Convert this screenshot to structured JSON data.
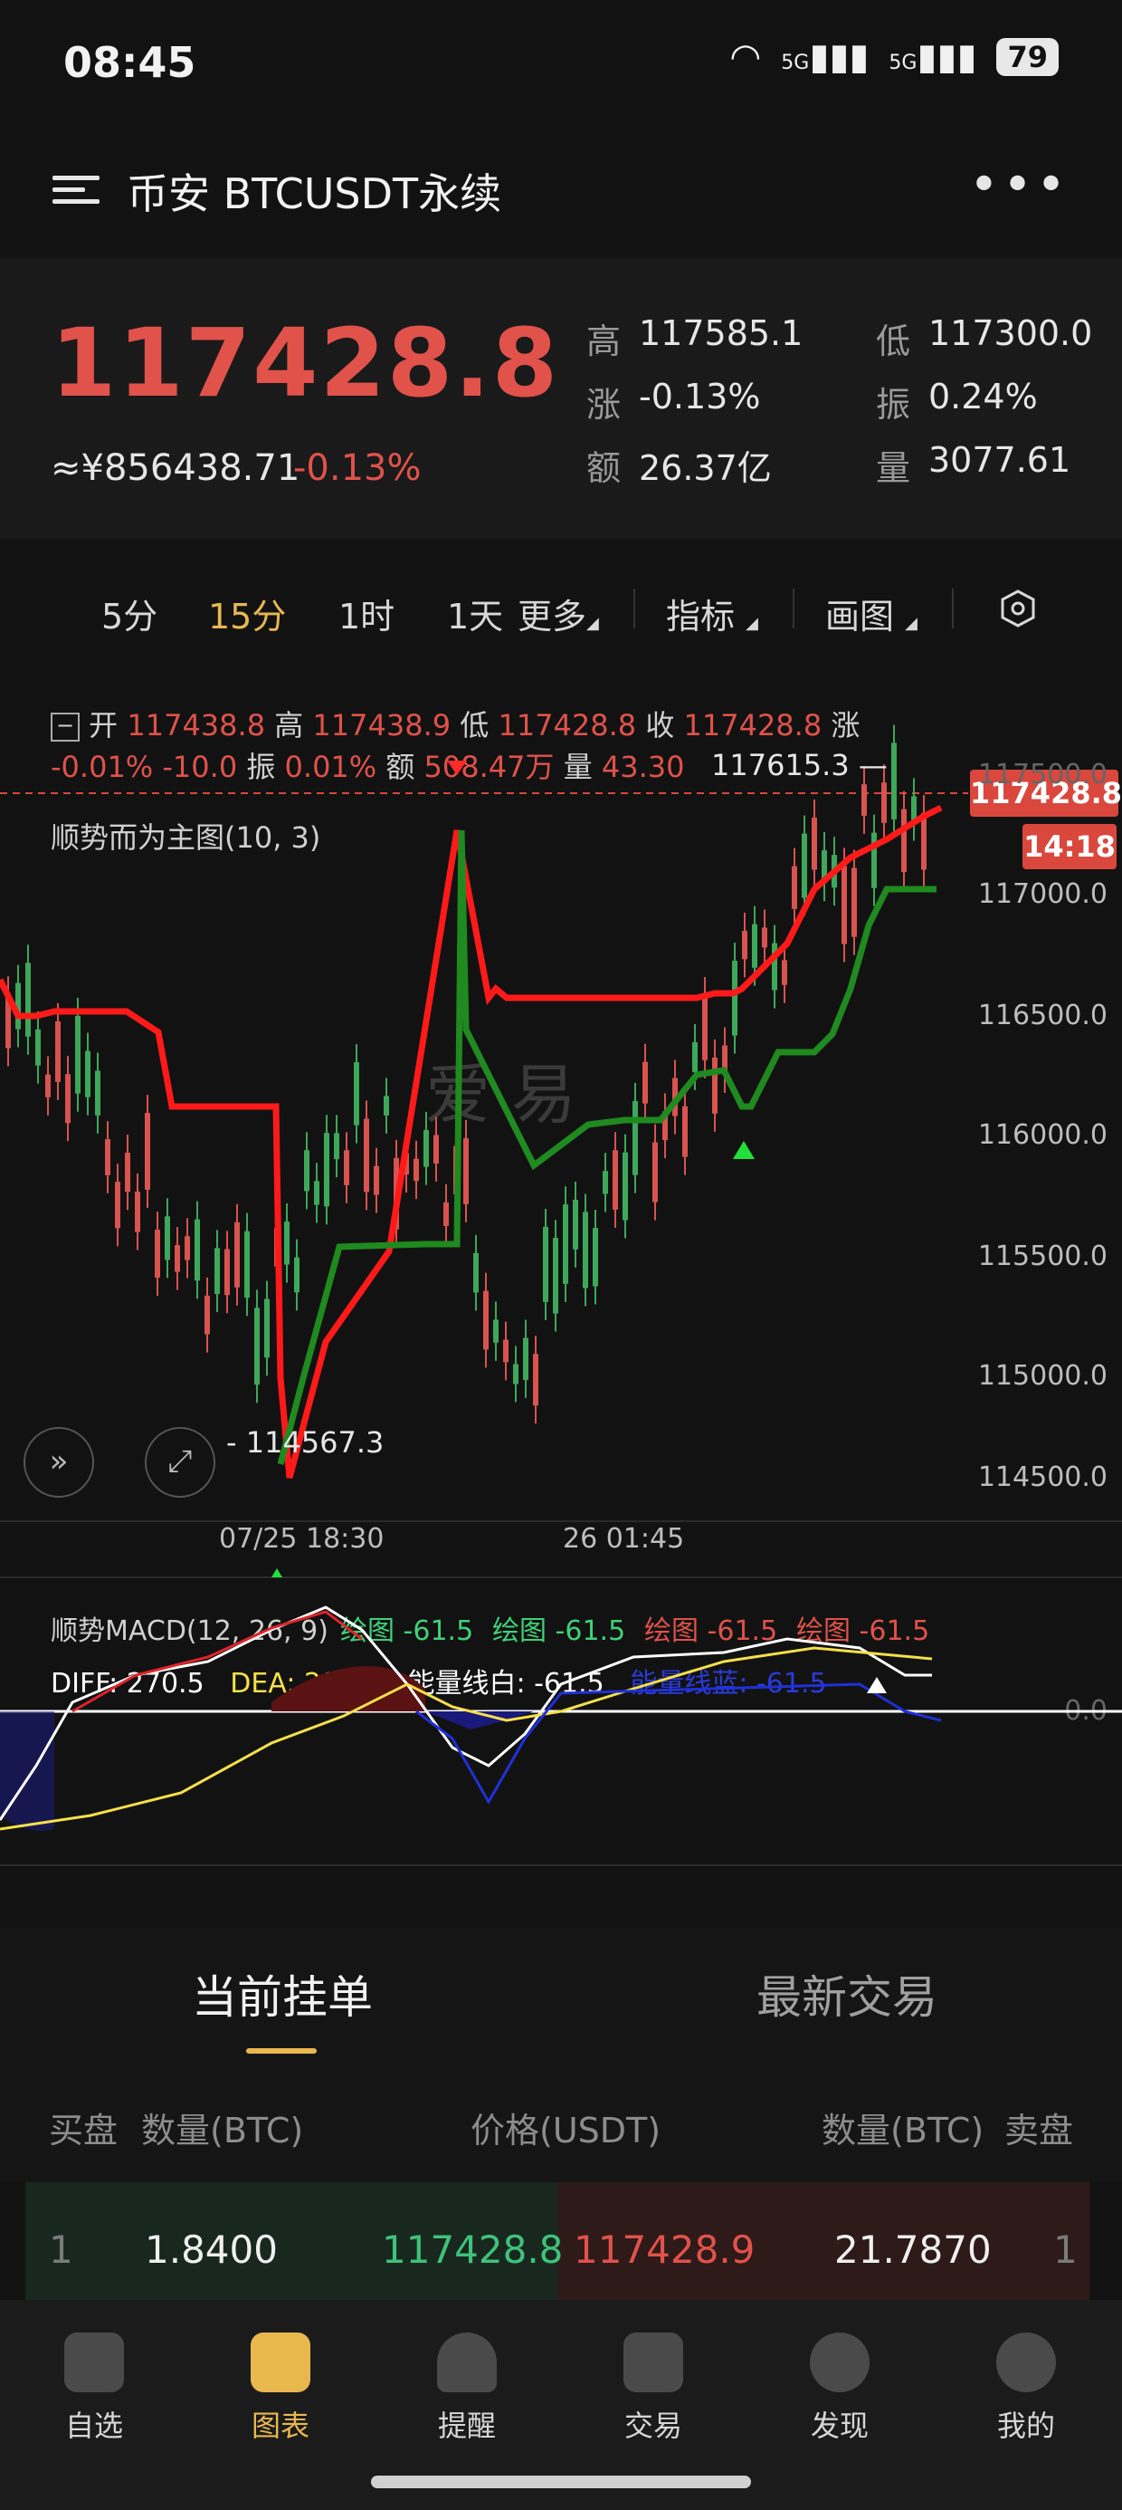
{
  "status_bar": {
    "time": "08:45",
    "signal1": "5G",
    "signal2": "5G",
    "battery": "79"
  },
  "header": {
    "title": "币安 BTCUSDT永续"
  },
  "ticker": {
    "last_price": "117428.8",
    "cny_price": "≈¥856438.71",
    "change_pct": "-0.13%",
    "stats": [
      {
        "label": "高",
        "value": "117585.1"
      },
      {
        "label": "低",
        "value": "117300.0"
      },
      {
        "label": "涨",
        "value": "-0.13%"
      },
      {
        "label": "振",
        "value": "0.24%"
      },
      {
        "label": "额",
        "value": "26.37亿"
      },
      {
        "label": "量",
        "value": "3077.61"
      }
    ]
  },
  "timeframes": {
    "items": [
      "5分",
      "15分",
      "1时",
      "1天",
      "更多"
    ],
    "active": "15分",
    "indicator": "指标",
    "draw": "画图"
  },
  "chart": {
    "ohlc": {
      "open_label": "开",
      "open": "117438.8",
      "high_label": "高",
      "high": "117438.9",
      "low_label": "低",
      "low": "117428.8",
      "close_label": "收",
      "close": "117428.8",
      "chg_label": "涨",
      "chg_pct": "-0.01%",
      "chg_abs": "-10.0",
      "amp_label": "振",
      "amp": "0.01%",
      "amt_label": "额",
      "amt": "508.47万",
      "vol_label": "量",
      "vol": "43.30"
    },
    "indicator_label": "顺势而为主图(10, 3)",
    "price_tag": "117428.8",
    "countdown": "14:18",
    "high_marker": "117615.3",
    "low_marker": "114567.3",
    "watermark": "爱 易",
    "y_ticks": [
      "117500.0",
      "117000.0",
      "116500.0",
      "116000.0",
      "115500.0",
      "115000.0",
      "114500.0"
    ],
    "x_ticks": [
      "07/25 18:30",
      "26 01:45"
    ]
  },
  "macd": {
    "title": "顺势MACD(12, 26, 9)",
    "plots": [
      {
        "label": "绘图 -61.5",
        "color": "#3fd27a"
      },
      {
        "label": "绘图 -61.5",
        "color": "#3fd27a"
      },
      {
        "label": "绘图 -61.5",
        "color": "#e0524a"
      },
      {
        "label": "绘图 -61.5",
        "color": "#e0524a"
      }
    ],
    "diff": "DIFF: 270.5",
    "dea": "DEA: 288.0",
    "energy_white": "能量线白: -61.5",
    "energy_blue": "能量线蓝: -61.5",
    "zero_tick": "0.0"
  },
  "tabs": {
    "orders": "当前挂单",
    "trades": "最新交易"
  },
  "order_book": {
    "headers": {
      "bid": "买盘",
      "bid_qty": "数量(BTC)",
      "price": "价格(USDT)",
      "ask_qty": "数量(BTC)",
      "ask": "卖盘"
    },
    "rows": [
      {
        "bid_idx": "1",
        "bid_qty": "1.8400",
        "bid_price": "117428.8",
        "ask_price": "117428.9",
        "ask_qty": "21.7870",
        "ask_idx": "1"
      }
    ]
  },
  "bottom_nav": {
    "items": [
      "自选",
      "图表",
      "提醒",
      "交易",
      "发现",
      "我的"
    ],
    "active": "图表"
  }
}
